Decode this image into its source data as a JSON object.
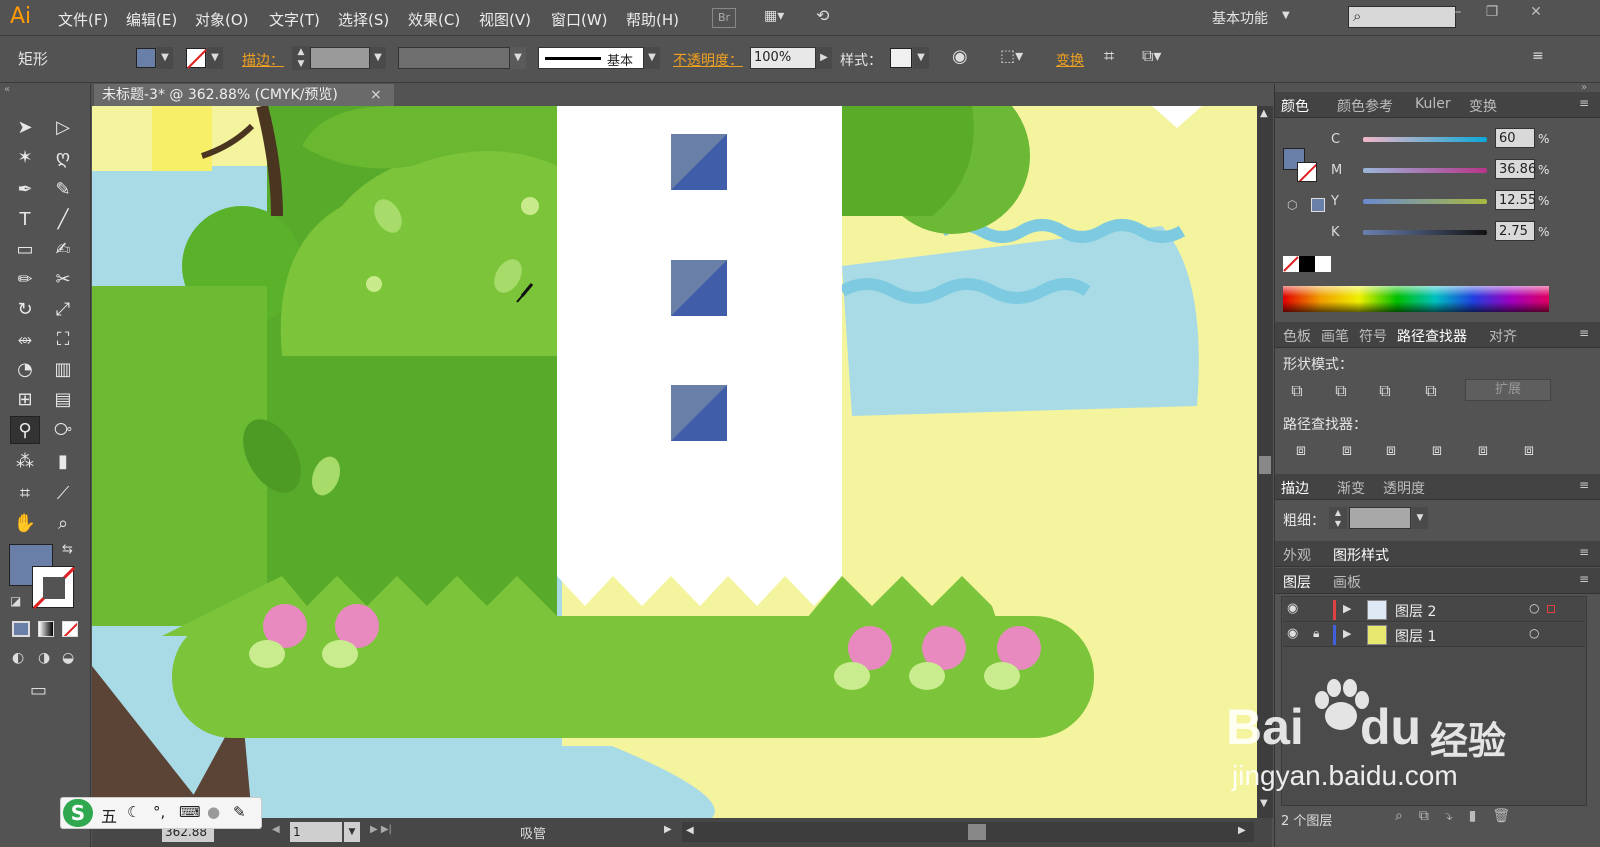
{
  "app": {
    "logo": "Ai",
    "workspace": "基本功能"
  },
  "menu": [
    "文件(F)",
    "编辑(E)",
    "对象(O)",
    "文字(T)",
    "选择(S)",
    "效果(C)",
    "视图(V)",
    "窗口(W)",
    "帮助(H)"
  ],
  "menu_icons": {
    "bridge": "Br",
    "arrange": "arrange-documents-icon",
    "sync": "sync-icon"
  },
  "control": {
    "object_type": "矩形",
    "stroke_label": "描边：",
    "stroke_style": "基本",
    "opacity_label": "不透明度：",
    "opacity_value": "100%",
    "style_label": "样式：",
    "transform_label": "变换",
    "fill_color": "#6a7fa8"
  },
  "document": {
    "tab_title": "未标题-3* @ 362.88% (CMYK/预览)",
    "close": "×"
  },
  "status": {
    "zoom": "362.88",
    "page": "1",
    "tool": "吸管"
  },
  "color_panel": {
    "tabs": [
      "颜色",
      "颜色参考",
      "Kuler",
      "变换"
    ],
    "channels": [
      {
        "name": "C",
        "value": "60"
      },
      {
        "name": "M",
        "value": "36.86"
      },
      {
        "name": "Y",
        "value": "12.55"
      },
      {
        "name": "K",
        "value": "2.75"
      }
    ],
    "percent": "%"
  },
  "pathfinder_panel": {
    "tabs": [
      "色板",
      "画笔",
      "符号",
      "路径查找器",
      "对齐"
    ],
    "shape_modes": "形状模式：",
    "expand": "扩展",
    "pathfinders": "路径查找器："
  },
  "stroke_panel": {
    "tabs": [
      "描边",
      "渐变",
      "透明度"
    ],
    "weight_label": "粗细："
  },
  "appearance_panel": {
    "tabs": [
      "外观",
      "图形样式"
    ]
  },
  "layers_panel": {
    "tabs": [
      "图层",
      "画板"
    ],
    "layers": [
      {
        "name": "图层 2",
        "color": "#e04040"
      },
      {
        "name": "图层 1",
        "color": "#4060e0"
      }
    ],
    "footer": "2 个图层"
  },
  "ime": {
    "mode": "五"
  },
  "watermark": {
    "brand": "Bai",
    "brand2": "du",
    "cn": "经验",
    "url": "jingyan.baidu.com"
  }
}
